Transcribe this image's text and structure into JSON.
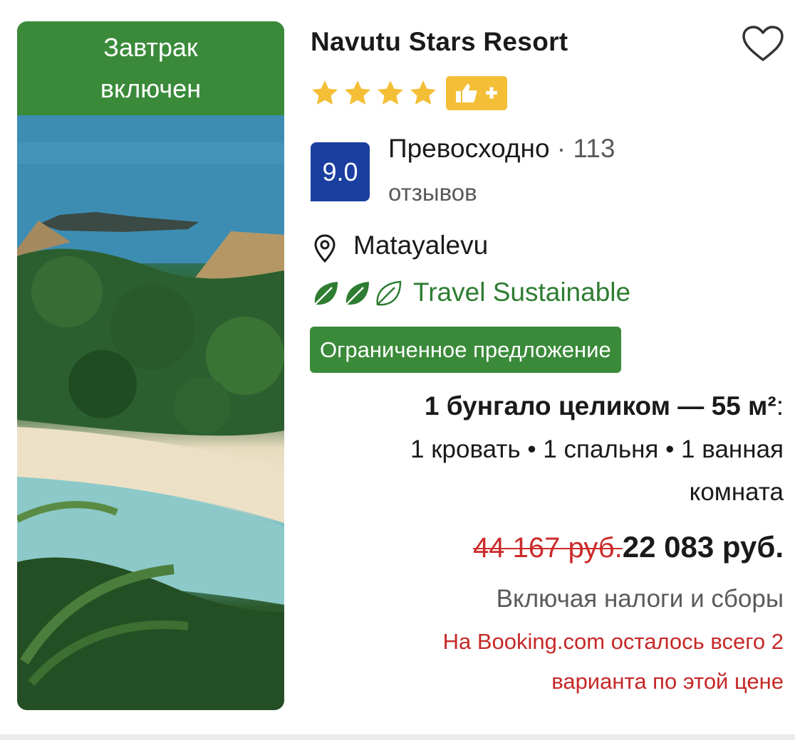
{
  "colors": {
    "badge_green": "#3a8a3a",
    "star_yellow": "#f4bf37",
    "score_blue": "#1a3fa0",
    "sustain_green": "#2e7d32",
    "price_red": "#cc2b2b"
  },
  "photo": {
    "badge_line1": "Завтрак",
    "badge_line2": "включен"
  },
  "hotel": {
    "name": "Navutu Stars Resort",
    "stars": 4,
    "favorite_icon": "heart-outline-icon"
  },
  "rating": {
    "score": "9.0",
    "word": "Превосходно",
    "separator": " · ",
    "count": "113",
    "count_label": "отзывов"
  },
  "location": {
    "icon": "map-pin-icon",
    "name": "Matayalevu"
  },
  "sustainability": {
    "level": "3 of 3 leaves",
    "label": "Travel Sustainable"
  },
  "deal": {
    "label": "Ограниченное предложение"
  },
  "unit": {
    "title": "1 бунгало целиком — 55 м²",
    "title_colon": ":",
    "details_line1": "1 кровать • 1 спальня • 1 ванная",
    "details_line2": "комната"
  },
  "price": {
    "old": "44 167 руб.",
    "new": "22 083 руб.",
    "taxes_note": "Включая налоги и сборы"
  },
  "availability": {
    "line1": "На Booking.com осталось всего 2",
    "line2": "варианта по этой цене"
  }
}
